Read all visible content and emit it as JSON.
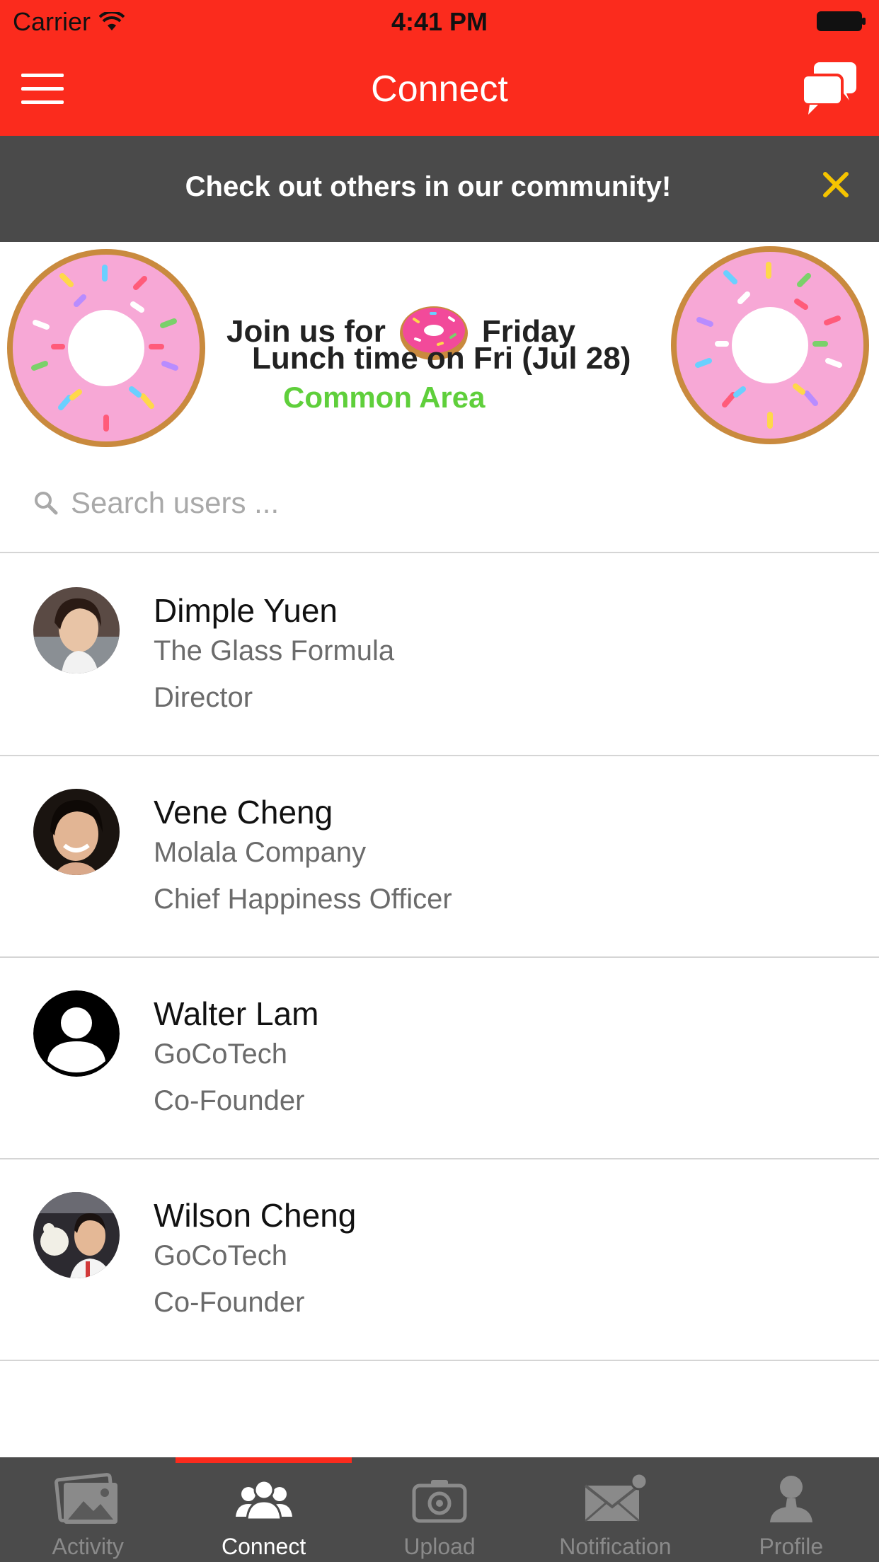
{
  "status_bar": {
    "carrier": "Carrier",
    "time": "4:41 PM"
  },
  "nav": {
    "title": "Connect"
  },
  "notice": {
    "text": "Check out others in our community!",
    "accent": "#f5c400"
  },
  "banner": {
    "line1_a": "Join us for",
    "line1_b": "Friday",
    "line2": "Lunch time on Fri (Jul 28)",
    "line3": "Common Area"
  },
  "search": {
    "placeholder": "Search users ..."
  },
  "users": [
    {
      "name": "Dimple Yuen",
      "company": "The Glass Formula",
      "title": "Director"
    },
    {
      "name": "Vene Cheng",
      "company": "Molala Company",
      "title": "Chief Happiness Officer"
    },
    {
      "name": "Walter Lam",
      "company": "GoCoTech",
      "title": "Co-Founder"
    },
    {
      "name": "Wilson Cheng",
      "company": "GoCoTech",
      "title": "Co-Founder"
    }
  ],
  "tabs": [
    {
      "label": "Activity",
      "icon": "photos-icon"
    },
    {
      "label": "Connect",
      "icon": "people-icon",
      "active": true
    },
    {
      "label": "Upload",
      "icon": "camera-icon"
    },
    {
      "label": "Notification",
      "icon": "envelope-icon"
    },
    {
      "label": "Profile",
      "icon": "person-icon"
    }
  ],
  "colors": {
    "brand_red": "#fb2b1d",
    "notice_bg": "#4a4a4a",
    "tabbar_bg": "#4b4b4b",
    "banner_green": "#5fcf3b"
  }
}
